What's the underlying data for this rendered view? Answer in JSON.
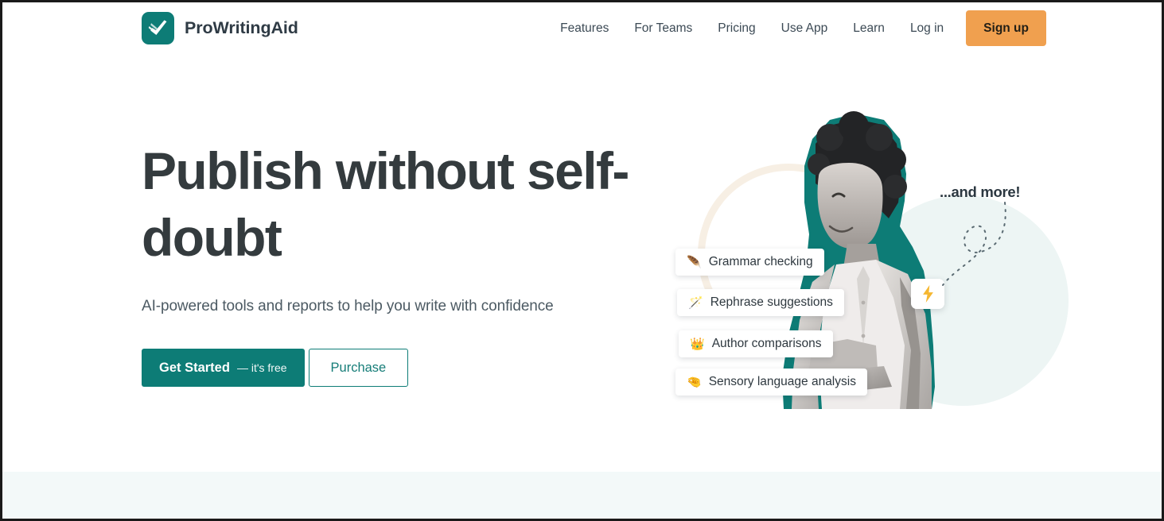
{
  "brand": {
    "name": "ProWritingAid",
    "logo_icon": "open-book-check-icon",
    "logo_color": "#0d7c76"
  },
  "header": {
    "nav_links": [
      {
        "label": "Features"
      },
      {
        "label": "For Teams"
      },
      {
        "label": "Pricing"
      },
      {
        "label": "Use App"
      },
      {
        "label": "Learn"
      },
      {
        "label": "Log in"
      }
    ],
    "signup_label": "Sign up",
    "signup_color": "#f0a04f"
  },
  "hero": {
    "title": "Publish without self-doubt",
    "subtitle": "AI-powered tools and reports to help you write with confidence",
    "primary_cta": {
      "label": "Get Started",
      "suffix": "— it's free",
      "color": "#0d7c76"
    },
    "secondary_cta": {
      "label": "Purchase"
    },
    "and_more_label": "...and more!",
    "bolt_icon": "lightning-bolt-icon",
    "feature_pills": [
      {
        "icon": "feather-quill-icon",
        "emoji": "🪶",
        "label": "Grammar checking"
      },
      {
        "icon": "magic-wand-icon",
        "emoji": "🪄",
        "label": "Rephrase suggestions"
      },
      {
        "icon": "crown-icon",
        "emoji": "👑",
        "label": "Author comparisons"
      },
      {
        "icon": "hand-sensory-icon",
        "emoji": "🤏",
        "label": "Sensory language analysis"
      }
    ],
    "portrait_alt": "smiling-woman-photo",
    "accent_mint": "#edf5f4",
    "accent_peach": "#f7efe4"
  },
  "bottom_band": {
    "color": "#f3f9f9"
  }
}
